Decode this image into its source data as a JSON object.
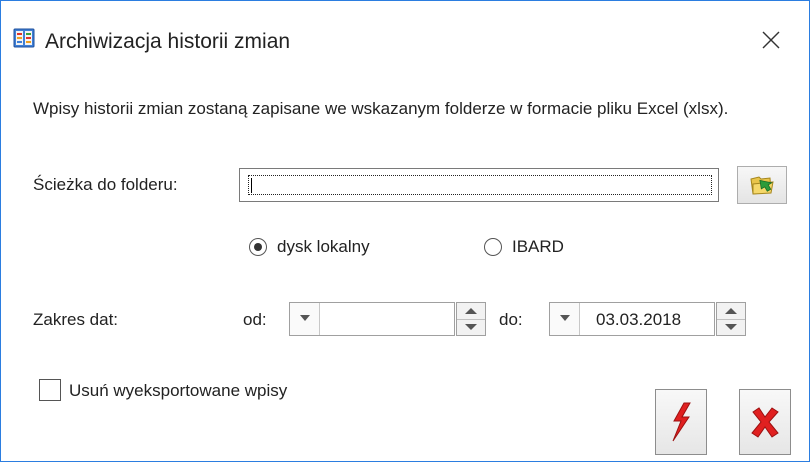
{
  "window": {
    "title": "Archiwizacja historii zmian",
    "icon": "archive-book-icon",
    "border_color": "#2b7de0"
  },
  "description": "Wpisy historii zmian zostaną zapisane we wskazanym folderze w formacie pliku Excel (xlsx).",
  "folder": {
    "label": "Ścieżka do folderu:",
    "value": "",
    "browse_icon": "open-folder-icon"
  },
  "location": {
    "options": [
      {
        "label": "dysk lokalny",
        "selected": true
      },
      {
        "label": "IBARD",
        "selected": false
      }
    ]
  },
  "date_range": {
    "label": "Zakres dat:",
    "from_label": "od:",
    "from_value": "",
    "to_label": "do:",
    "to_value": "03.03.2018"
  },
  "delete_exported": {
    "label": "Usuń wyeksportowane wpisy",
    "checked": false
  },
  "actions": {
    "run_icon": "lightning-icon",
    "cancel_icon": "red-x-icon",
    "run_color": "#e02020",
    "cancel_color": "#e02020"
  }
}
